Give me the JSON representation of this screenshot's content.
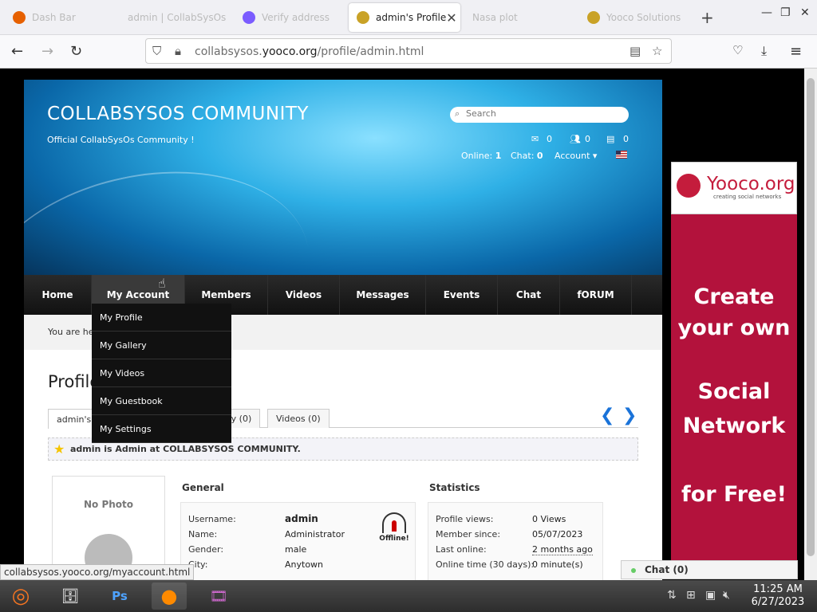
{
  "browser": {
    "tabs": [
      {
        "label": "Dash Bar",
        "active": false
      },
      {
        "label": "admin | CollabSysOs",
        "active": false
      },
      {
        "label": "Verify address",
        "active": false
      },
      {
        "label": "admin's Profile",
        "active": true
      },
      {
        "label": "Nasa plot",
        "active": false
      },
      {
        "label": "Yooco Solutions",
        "active": false
      }
    ],
    "url_prefix": "collabsysos.",
    "url_domain": "yooco.org",
    "url_path": "/profile/admin.html",
    "status_url": "collabsysos.yooco.org/myaccount.html"
  },
  "site": {
    "title": "COLLABSYSOS COMMUNITY",
    "subtitle": "Official CollabSysOs Community !",
    "search_placeholder": "Search",
    "counters": {
      "mail": "0",
      "friends": "0",
      "notes": "0"
    },
    "online_label": "Online:",
    "online_value": "1",
    "chat_label": "Chat:",
    "chat_value": "0",
    "account_label": "Account ▾"
  },
  "menu": {
    "items": [
      "Home",
      "My Account",
      "Members",
      "Videos",
      "Messages",
      "Events",
      "Chat",
      "fORUM"
    ],
    "dropdown": [
      "My Profile",
      "My Gallery",
      "My Videos",
      "My Guestbook",
      "My Settings"
    ]
  },
  "breadcrumb": "You are here",
  "profile": {
    "title": "Profile",
    "tabs": [
      "admin's",
      "Gallery (0)",
      "Videos (0)"
    ],
    "notice": "admin is Admin at COLLABSYSOS COMMUNITY.",
    "no_photo": "No Photo",
    "general": {
      "heading": "General",
      "rows": [
        {
          "label": "Username:",
          "value": "admin"
        },
        {
          "label": "Name:",
          "value": "Administrator"
        },
        {
          "label": "Gender:",
          "value": "male"
        },
        {
          "label": "City:",
          "value": "Anytown"
        }
      ],
      "offline_label": "Offline!"
    },
    "statistics": {
      "heading": "Statistics",
      "rows": [
        {
          "label": "Profile views:",
          "value": "0 Views"
        },
        {
          "label": "Member since:",
          "value": "05/07/2023"
        },
        {
          "label": "Last online:",
          "value": "2 months ago"
        },
        {
          "label": "Online time (30 days):",
          "value": "0 minute(s)"
        }
      ]
    }
  },
  "ad": {
    "brand": "Yooco.org",
    "tagline": "creating social networks",
    "lines": [
      "Create",
      "your own",
      "Social",
      "Network",
      "for Free!"
    ]
  },
  "chatbar": {
    "label": "Chat (0)"
  },
  "taskbar": {
    "time": "11:25 AM",
    "date": "6/27/2023",
    "ps_label": "Ps"
  }
}
